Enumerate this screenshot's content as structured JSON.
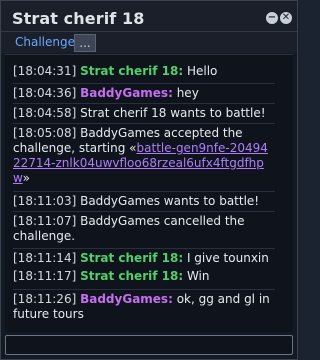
{
  "window": {
    "title": "Strat cherif 18"
  },
  "tabs": {
    "challenge_label": "Challenge",
    "more_label": "..."
  },
  "messages": [
    {
      "time": "[18:04:31]",
      "user": "Strat cherif 18:",
      "text": "Hello"
    },
    {
      "time": "[18:04:36]",
      "user": "BaddyGames:",
      "text": "hey"
    },
    {
      "time": "[18:04:58]",
      "text": "Strat cherif 18 wants to battle!"
    },
    {
      "time": "[18:05:08]",
      "text_before": "BaddyGames accepted the challenge, starting «",
      "link": "battle-gen9nfe-2049422714-znlk04uwvfloo68rzeal6ufx4ftgdfhpw",
      "text_after": "»"
    },
    {
      "time": "[18:11:03]",
      "text": "BaddyGames wants to battle!"
    },
    {
      "time": "[18:11:07]",
      "text": "BaddyGames cancelled the challenge."
    },
    {
      "time": "[18:11:14]",
      "user": "Strat cherif 18:",
      "text": "I give tounxin"
    },
    {
      "time": "[18:11:17]",
      "user": "Strat cherif 18:",
      "text": "Win"
    },
    {
      "time": "[18:11:26]",
      "user": "BaddyGames:",
      "text": "ok, gg and gl in future tours"
    }
  ],
  "colors": {
    "strat_user": "#4fd06a",
    "baddy_user": "#c66df0",
    "link": "#b07dff"
  },
  "icons": {
    "minimize": "minimize-icon",
    "close": "close-icon"
  },
  "input": {
    "value": ""
  }
}
